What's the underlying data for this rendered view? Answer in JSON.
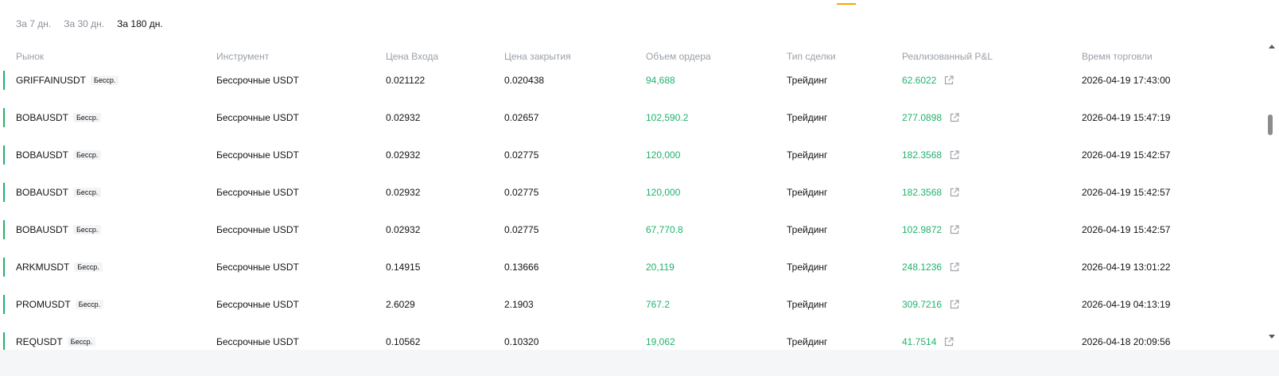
{
  "period_tabs": [
    "За 7 дн.",
    "За 30 дн.",
    "За 180 дн."
  ],
  "active_period": "За 180 дн.",
  "columns": [
    "Рынок",
    "Инструмент",
    "Цена Входа",
    "Цена закрытия",
    "Объем ордера",
    "Тип сделки",
    "Реализованный P&L",
    "Время торговли"
  ],
  "rows": [
    {
      "market": "GRIFFAINUSDT",
      "badge": "Бесср.",
      "instrument": "Бессрочные USDT",
      "entry": "0.021122",
      "close": "0.020438",
      "volume": "94,688",
      "type": "Трейдинг",
      "pnl": "62.6022",
      "time": "2026-04-19 17:43:00"
    },
    {
      "market": "BOBAUSDT",
      "badge": "Бесср.",
      "instrument": "Бессрочные USDT",
      "entry": "0.02932",
      "close": "0.02657",
      "volume": "102,590.2",
      "type": "Трейдинг",
      "pnl": "277.0898",
      "time": "2026-04-19 15:47:19"
    },
    {
      "market": "BOBAUSDT",
      "badge": "Бесср.",
      "instrument": "Бессрочные USDT",
      "entry": "0.02932",
      "close": "0.02775",
      "volume": "120,000",
      "type": "Трейдинг",
      "pnl": "182.3568",
      "time": "2026-04-19 15:42:57"
    },
    {
      "market": "BOBAUSDT",
      "badge": "Бесср.",
      "instrument": "Бессрочные USDT",
      "entry": "0.02932",
      "close": "0.02775",
      "volume": "120,000",
      "type": "Трейдинг",
      "pnl": "182.3568",
      "time": "2026-04-19 15:42:57"
    },
    {
      "market": "BOBAUSDT",
      "badge": "Бесср.",
      "instrument": "Бессрочные USDT",
      "entry": "0.02932",
      "close": "0.02775",
      "volume": "67,770.8",
      "type": "Трейдинг",
      "pnl": "102.9872",
      "time": "2026-04-19 15:42:57"
    },
    {
      "market": "ARKMUSDT",
      "badge": "Бесср.",
      "instrument": "Бессрочные USDT",
      "entry": "0.14915",
      "close": "0.13666",
      "volume": "20,119",
      "type": "Трейдинг",
      "pnl": "248.1236",
      "time": "2026-04-19 13:01:22"
    },
    {
      "market": "PROMUSDT",
      "badge": "Бесср.",
      "instrument": "Бессрочные USDT",
      "entry": "2.6029",
      "close": "2.1903",
      "volume": "767.2",
      "type": "Трейдинг",
      "pnl": "309.7216",
      "time": "2026-04-19 04:13:19"
    },
    {
      "market": "REQUSDT",
      "badge": "Бесср.",
      "instrument": "Бессрочные USDT",
      "entry": "0.10562",
      "close": "0.10320",
      "volume": "19,062",
      "type": "Трейдинг",
      "pnl": "41.7514",
      "time": "2026-04-18 20:09:56"
    }
  ],
  "colors": {
    "profit": "#20b26c",
    "accent": "#f7a600",
    "text": "#121214",
    "muted": "#9aa0a8"
  },
  "icons": {
    "pnl_link": "external-link-icon"
  }
}
